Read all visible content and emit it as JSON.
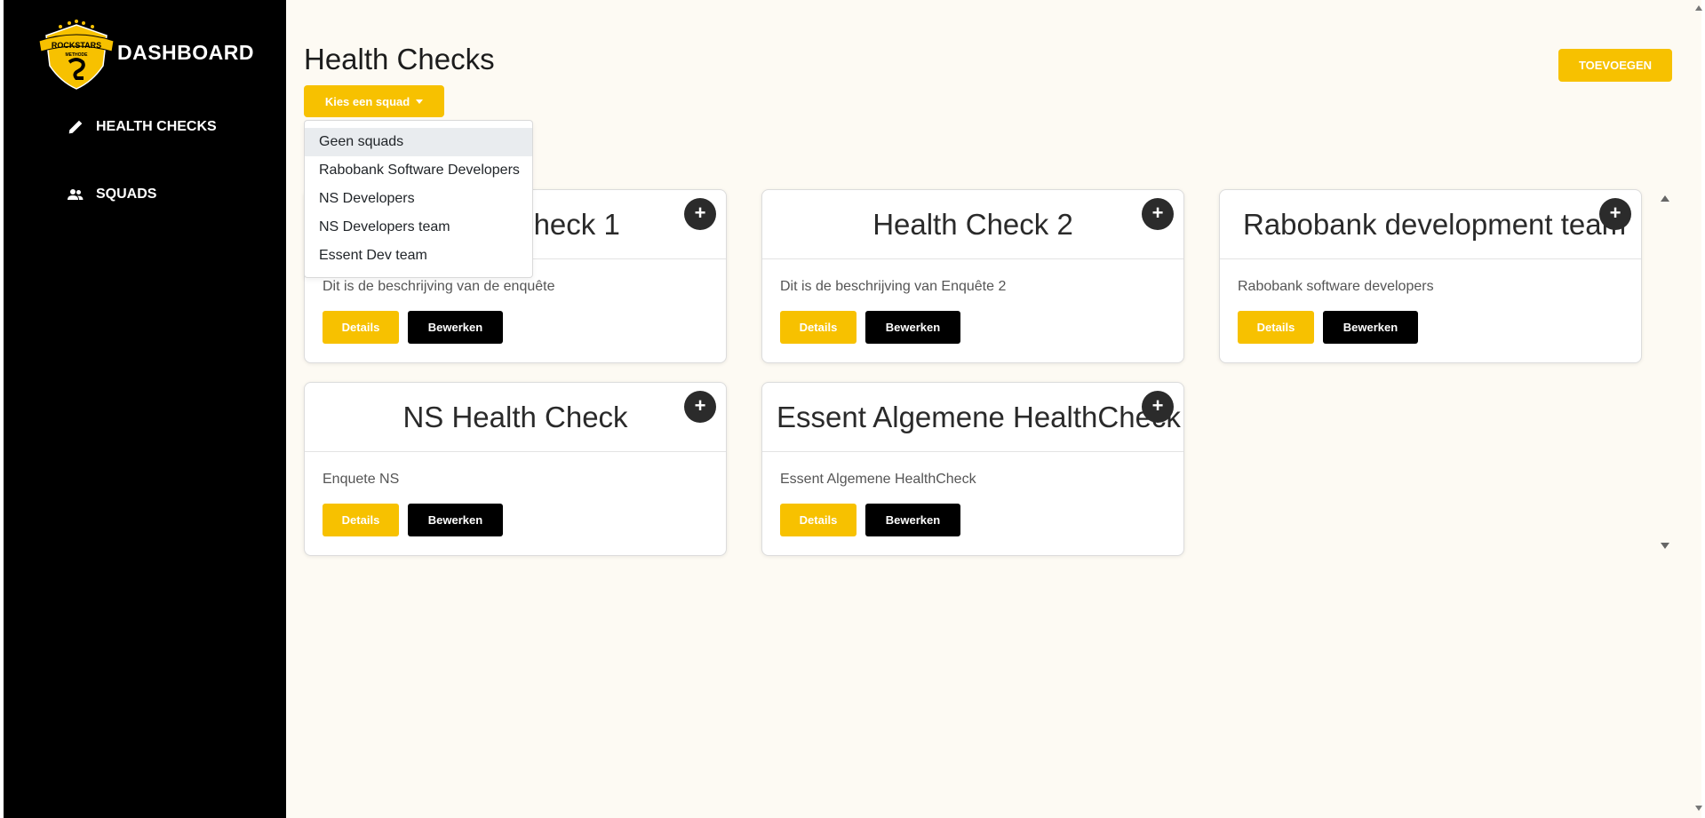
{
  "sidebar": {
    "brand": "DASHBOARD",
    "logo_text": "ROCKSTARS",
    "items": [
      {
        "label": "HEALTH CHECKS",
        "icon": "pencil-icon"
      },
      {
        "label": "SQUADS",
        "icon": "users-icon"
      }
    ]
  },
  "main": {
    "title": "Health Checks",
    "add_button": "TOEVOEGEN",
    "squad_button": "Kies een squad",
    "squad_options": [
      "Geen squads",
      "Rabobank Software Developers",
      "NS Developers",
      "NS Developers team",
      "Essent Dev team"
    ],
    "details_label": "Details",
    "edit_label": "Bewerken",
    "plus_label": "+",
    "cards": [
      {
        "title": "Health Check 1",
        "description": "Dit is de beschrijving van de enquête"
      },
      {
        "title": "Health Check 2",
        "description": "Dit is de beschrijving van Enquête 2"
      },
      {
        "title": "Rabobank development team",
        "description": "Rabobank software developers"
      },
      {
        "title": "NS Health Check",
        "description": "Enquete NS"
      },
      {
        "title": "Essent Algemene HealthCheck",
        "description": "Essent Algemene HealthCheck"
      }
    ]
  },
  "colors": {
    "accent": "#f7c100",
    "sidebar": "#000000",
    "background": "#fdfaf3"
  }
}
